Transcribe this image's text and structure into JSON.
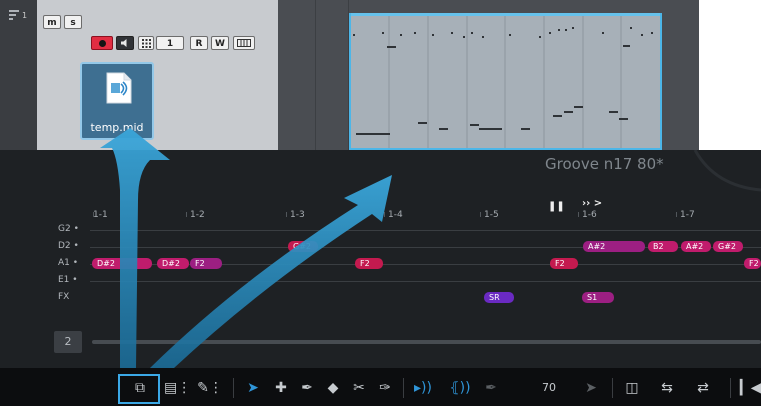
{
  "track": {
    "number": "1",
    "mute_label": "m",
    "solo_label": "s",
    "channel_label": "1",
    "read_label": "R",
    "write_label": "W"
  },
  "file": {
    "name": "temp.mid"
  },
  "editor": {
    "groove_title": "Groove n17 80*",
    "ruler": [
      "1-1",
      "1-2",
      "1-3",
      "1-4",
      "1-5",
      "1-6",
      "1-7"
    ],
    "rows": [
      "G2",
      "D2",
      "A1",
      "E1",
      "FX"
    ],
    "notes": [
      {
        "label": "D#2",
        "color": "#c01c6c"
      },
      {
        "label": "D#2",
        "color": "#c01c6c"
      },
      {
        "label": "F2",
        "color": "#9c1f82"
      },
      {
        "label": "G#2",
        "color": "#c41a4f"
      },
      {
        "label": "F2",
        "color": "#c41a4f"
      },
      {
        "label": "F2",
        "color": "#c41a4f"
      },
      {
        "label": "A#2",
        "color": "#9c1f82"
      },
      {
        "label": "B2",
        "color": "#c01c6c"
      },
      {
        "label": "A#2",
        "color": "#c01c6c"
      },
      {
        "label": "G#2",
        "color": "#c01c6c"
      },
      {
        "label": "F2",
        "color": "#c01c6c"
      },
      {
        "label": "SR",
        "color": "#6a2ac2"
      },
      {
        "label": "S1",
        "color": "#9c1f82"
      }
    ],
    "track_count": "2"
  },
  "toolbar": {
    "velocity_value": "70"
  },
  "colors": {
    "accent": "#3ba8e6",
    "note_pink": "#c01c6c",
    "note_purple": "#9c1f82"
  }
}
